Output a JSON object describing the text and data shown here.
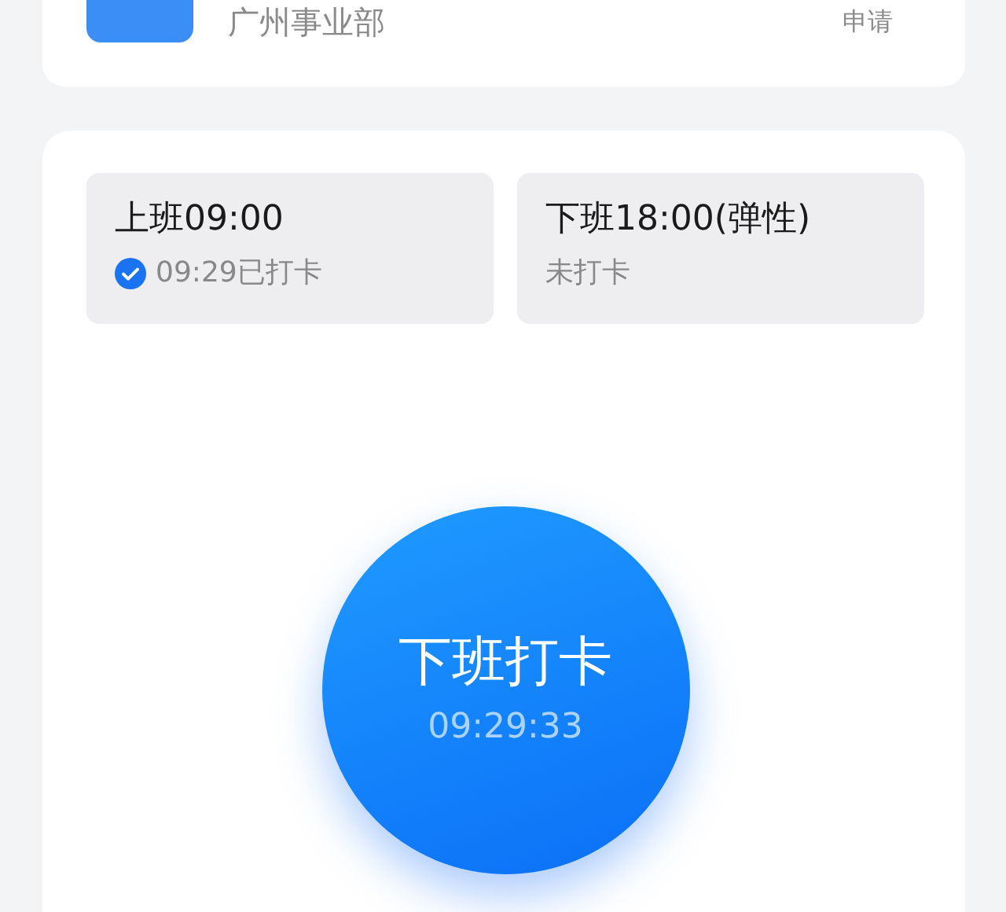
{
  "header": {
    "department": "广州事业部",
    "apply_link": "申请"
  },
  "shifts": [
    {
      "title": "上班09:00",
      "status": "09:29已打卡",
      "checked": true
    },
    {
      "title": "下班18:00(弹性)",
      "status": "未打卡",
      "checked": false
    }
  ],
  "punch_button": {
    "label": "下班打卡",
    "time": "09:29:33"
  }
}
